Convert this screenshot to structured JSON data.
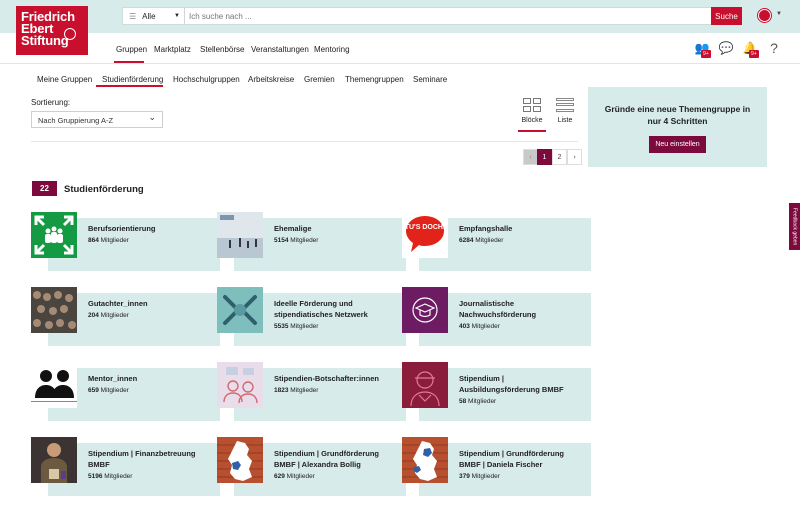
{
  "logo": {
    "lines": [
      "Friedrich",
      "Ebert",
      "Stiftung"
    ]
  },
  "search": {
    "scope": "Alle",
    "placeholder": "Ich suche nach ...",
    "button": "Suche"
  },
  "main_nav": [
    "Gruppen",
    "Marktplatz",
    "Stellenbörse",
    "Veranstaltungen",
    "Mentoring"
  ],
  "header_icons": {
    "badge_1": "9+",
    "badge_2": "9+",
    "help": "?"
  },
  "sub_nav": [
    "Meine Gruppen",
    "Studienförderung",
    "Hochschulgruppen",
    "Arbeitskreise",
    "Gremien",
    "Themengruppen",
    "Seminare"
  ],
  "sort": {
    "label": "Sortierung:",
    "value": "Nach Gruppierung A-Z"
  },
  "view": {
    "blocks": "Blöcke",
    "list": "Liste"
  },
  "pagination": {
    "prev": "‹",
    "pages": [
      "1",
      "2"
    ],
    "next": "›"
  },
  "promo": {
    "title": "Gründe eine neue Themengruppe in nur 4 Schritten",
    "button": "Neu einstellen"
  },
  "feedback": "Feedback geben",
  "section": {
    "count": "22",
    "title": "Studienförderung"
  },
  "members_label": "Mitglieder",
  "groups": [
    {
      "name": "Berufsorientierung",
      "members": "864"
    },
    {
      "name": "Ehemalige",
      "members": "5154"
    },
    {
      "name": "Empfangshalle",
      "members": "6284",
      "thumb_text": "TU'S DOCH!"
    },
    {
      "name": "Gutachter_innen",
      "members": "204"
    },
    {
      "name": "Ideelle Förderung und stipendiatisches Netzwerk",
      "members": "5535"
    },
    {
      "name": "Journalistische Nachwuchsförderung",
      "members": "403"
    },
    {
      "name": "Mentor_innen",
      "members": "659"
    },
    {
      "name": "Stipendien-Botschafter:innen",
      "members": "1823"
    },
    {
      "name": "Stipendium | Ausbildungsförderung BMBF",
      "members": "58"
    },
    {
      "name": "Stipendium | Finanzbetreuung BMBF",
      "members": "5196"
    },
    {
      "name": "Stipendium | Grundförderung BMBF | Alexandra Bollig",
      "members": "629"
    },
    {
      "name": "Stipendium | Grundförderung BMBF | Daniela Fischer",
      "members": "379"
    }
  ]
}
